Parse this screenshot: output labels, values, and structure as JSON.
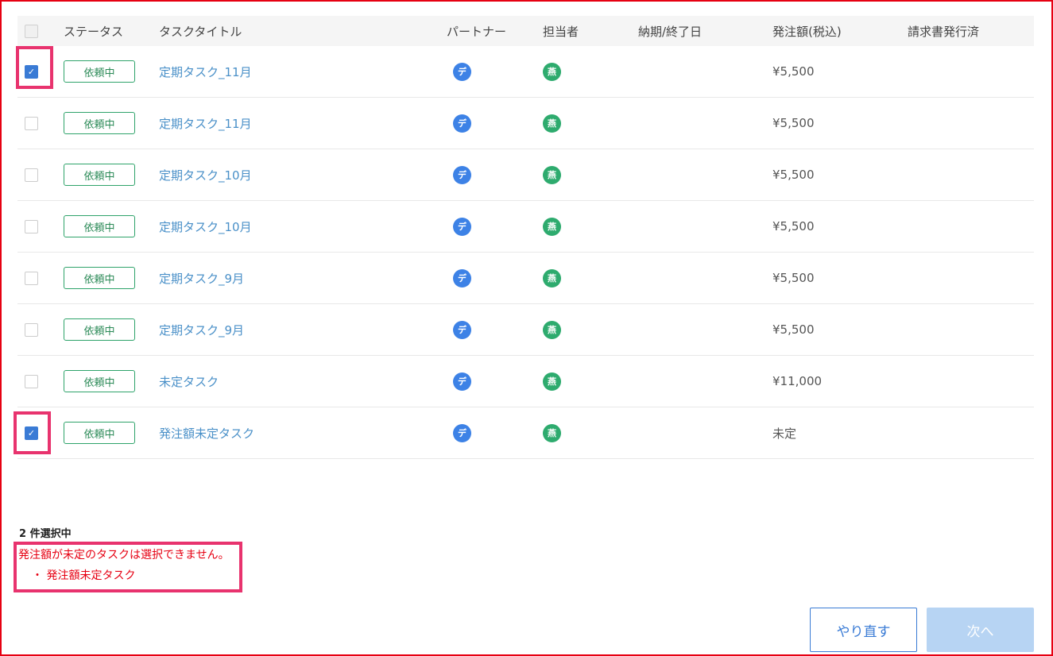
{
  "header": {
    "status": "ステータス",
    "title": "タスクタイトル",
    "partner": "パートナー",
    "assignee": "担当者",
    "due": "納期/終了日",
    "amount": "発注額(税込)",
    "invoice": "請求書発行済"
  },
  "rows": [
    {
      "checked": true,
      "status": "依頼中",
      "title": "定期タスク_11月",
      "partner": "デ",
      "assignee": "燕",
      "amount": "¥5,500"
    },
    {
      "checked": false,
      "status": "依頼中",
      "title": "定期タスク_11月",
      "partner": "デ",
      "assignee": "燕",
      "amount": "¥5,500"
    },
    {
      "checked": false,
      "status": "依頼中",
      "title": "定期タスク_10月",
      "partner": "デ",
      "assignee": "燕",
      "amount": "¥5,500"
    },
    {
      "checked": false,
      "status": "依頼中",
      "title": "定期タスク_10月",
      "partner": "デ",
      "assignee": "燕",
      "amount": "¥5,500"
    },
    {
      "checked": false,
      "status": "依頼中",
      "title": "定期タスク_9月",
      "partner": "デ",
      "assignee": "燕",
      "amount": "¥5,500"
    },
    {
      "checked": false,
      "status": "依頼中",
      "title": "定期タスク_9月",
      "partner": "デ",
      "assignee": "燕",
      "amount": "¥5,500"
    },
    {
      "checked": false,
      "status": "依頼中",
      "title": "未定タスク",
      "partner": "デ",
      "assignee": "燕",
      "amount": "¥11,000"
    },
    {
      "checked": true,
      "status": "依頼中",
      "title": "発注額未定タスク",
      "partner": "デ",
      "assignee": "燕",
      "amount": "未定"
    }
  ],
  "selection": {
    "count_label": "2 件選択中",
    "error_message": "発注額が未定のタスクは選択できません。",
    "error_item": "・ 発注額未定タスク"
  },
  "buttons": {
    "retry": "やり直す",
    "next": "次へ"
  },
  "colors": {
    "accent": "#3a7bd5",
    "status_green": "#2ea36a",
    "error_red": "#e60012",
    "highlight_pink": "#e8336e"
  }
}
